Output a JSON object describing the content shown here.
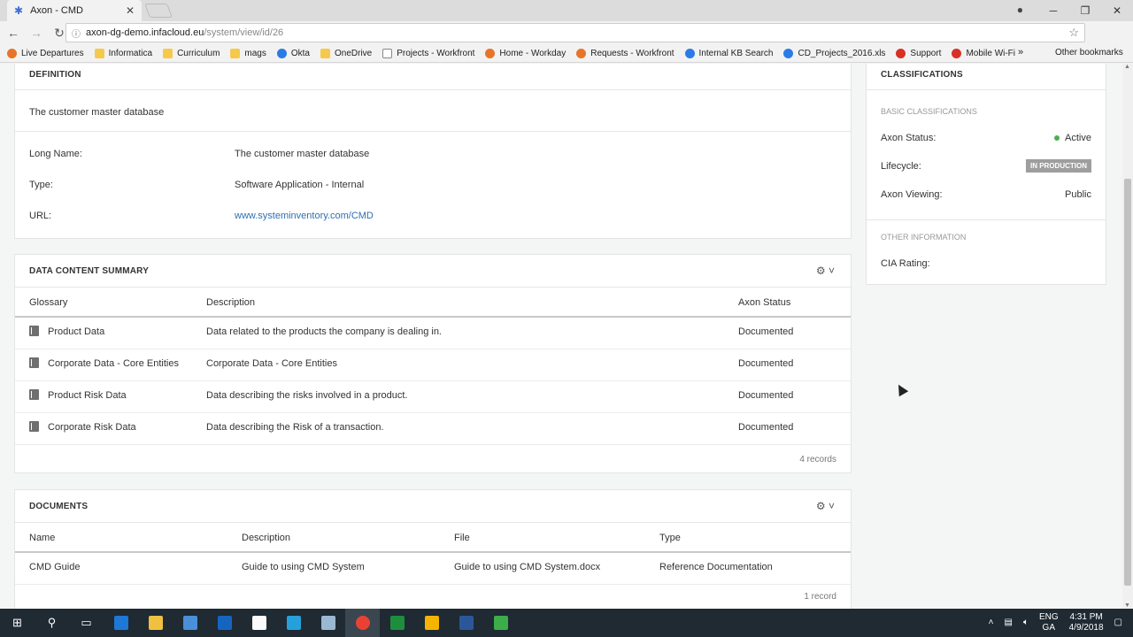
{
  "browser": {
    "tab_title": "Axon - CMD",
    "url_host": "axon-dg-demo.infacloud.eu",
    "url_path": "/system/view/id/26",
    "bookmarks": [
      {
        "label": "Live Departures",
        "icon": "orange"
      },
      {
        "label": "Informatica",
        "icon": "folder"
      },
      {
        "label": "Curriculum",
        "icon": "folder"
      },
      {
        "label": "mags",
        "icon": "folder"
      },
      {
        "label": "Okta",
        "icon": "blue"
      },
      {
        "label": "OneDrive",
        "icon": "folder"
      },
      {
        "label": "Projects - Workfront",
        "icon": "grey"
      },
      {
        "label": "Home - Workday",
        "icon": "orange"
      },
      {
        "label": "Requests - Workfront",
        "icon": "orange"
      },
      {
        "label": "Internal KB Search",
        "icon": "blue"
      },
      {
        "label": "CD_Projects_2016.xls",
        "icon": "blue"
      },
      {
        "label": "Support",
        "icon": "red"
      },
      {
        "label": "Mobile Wi-Fi",
        "icon": "red"
      }
    ],
    "more_bookmarks": "»",
    "other_bookmarks": "Other bookmarks"
  },
  "definition": {
    "title": "DEFINITION",
    "text": "The customer master database",
    "fields": [
      {
        "label": "Long Name:",
        "value": "The customer master database",
        "link": false
      },
      {
        "label": "Type:",
        "value": "Software Application - Internal",
        "link": false
      },
      {
        "label": "URL:",
        "value": "www.systeminventory.com/CMD",
        "link": true
      }
    ]
  },
  "data_content_summary": {
    "title": "DATA CONTENT SUMMARY",
    "columns": [
      "Glossary",
      "Description",
      "Axon Status"
    ],
    "rows": [
      {
        "glossary": "Product Data",
        "description": "Data related to the products the company is dealing in.",
        "status": "Documented"
      },
      {
        "glossary": "Corporate Data - Core Entities",
        "description": "Corporate Data - Core Entities",
        "status": "Documented"
      },
      {
        "glossary": "Product Risk Data",
        "description": "Data describing the risks involved in a product.",
        "status": "Documented"
      },
      {
        "glossary": "Corporate Risk Data",
        "description": "Data describing the Risk of a transaction.",
        "status": "Documented"
      }
    ],
    "records": "4 records"
  },
  "documents": {
    "title": "DOCUMENTS",
    "columns": [
      "Name",
      "Description",
      "File",
      "Type"
    ],
    "rows": [
      {
        "name": "CMD Guide",
        "description": "Guide to using CMD System",
        "file": "Guide to using CMD System.docx",
        "type": "Reference Documentation"
      }
    ],
    "records": "1 record"
  },
  "classifications": {
    "title": "CLASSIFICATIONS",
    "basic_title": "BASIC CLASSIFICATIONS",
    "axon_status_label": "Axon Status:",
    "axon_status_value": "Active",
    "lifecycle_label": "Lifecycle:",
    "lifecycle_value": "IN PRODUCTION",
    "viewing_label": "Axon Viewing:",
    "viewing_value": "Public",
    "other_title": "OTHER INFORMATION",
    "cia_label": "CIA Rating:"
  },
  "taskbar": {
    "language": "ENG",
    "region": "GA",
    "time": "4:31 PM",
    "date": "4/9/2018"
  },
  "colors": {
    "link": "#2f6fb0",
    "status_active": "#4caf50",
    "badge": "#9e9e9e",
    "taskbar": "#1f2a33"
  }
}
